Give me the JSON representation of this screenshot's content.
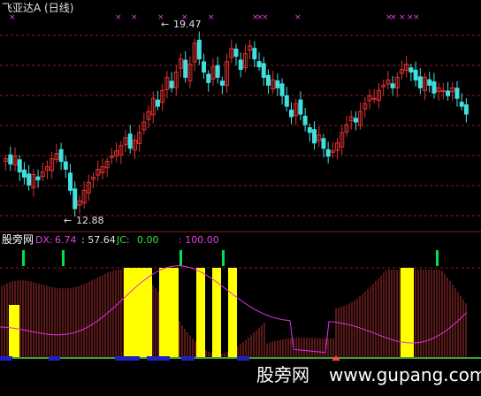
{
  "title": "飞亚达A (日线)",
  "high_label": "19.47",
  "low_label": "12.88",
  "indicator": {
    "name": "股旁网",
    "dx_label": "DX:",
    "dx_value": "6.74",
    "mid_value": ": 57.64",
    "jc_label": "JC:",
    "jc_value": "0.00",
    "last_value": ": 100.00"
  },
  "watermark": {
    "cn": "股旁网",
    "url": "www.gupang.com"
  },
  "colors": {
    "background": "#000000",
    "up": "#e03030",
    "down": "#40e0e0",
    "grid": "#8b2020",
    "marker": "#e040e0",
    "yellow": "#ffff00",
    "green": "#00e050",
    "purple_line": "#e030e0",
    "blue_bar": "#2020c0"
  },
  "chart_data": [
    {
      "type": "candlestick",
      "title": "飞亚达A (日线)",
      "close": [
        14.8,
        14.6,
        14.9,
        14.3,
        14.1,
        13.8,
        14.2,
        14.0,
        14.3,
        14.5,
        14.8,
        15.0,
        14.7,
        14.4,
        13.6,
        12.9,
        13.2,
        13.6,
        13.9,
        14.1,
        14.4,
        14.5,
        14.7,
        14.9,
        15.1,
        15.3,
        15.6,
        15.2,
        15.5,
        15.8,
        16.2,
        16.6,
        17.1,
        16.8,
        17.4,
        17.9,
        17.5,
        18.1,
        18.6,
        17.9,
        18.4,
        19.2,
        18.6,
        18.1,
        17.7,
        18.3,
        17.9,
        17.6,
        18.5,
        19.0,
        18.7,
        18.2,
        18.8,
        19.1,
        18.6,
        18.3,
        17.9,
        17.6,
        17.8,
        17.5,
        17.2,
        16.8,
        16.4,
        16.9,
        16.5,
        16.1,
        15.8,
        15.4,
        15.7,
        15.2,
        14.9,
        15.1,
        15.4,
        15.8,
        16.1,
        16.4,
        16.2,
        16.6,
        16.9,
        17.2,
        17.1,
        17.4,
        17.6,
        17.8,
        17.5,
        17.9,
        18.2,
        18.4,
        18.1,
        17.8,
        17.5,
        17.9,
        17.6,
        17.3,
        17.5,
        17.4,
        17.2,
        17.5,
        17.1,
        16.8,
        16.5
      ],
      "up_markers_x_index": [
        3,
        14,
        27,
        34,
        45,
        55,
        61,
        68,
        74,
        80,
        93,
        98
      ],
      "marked_values": {
        "high": 19.47,
        "low": 12.88
      }
    },
    {
      "type": "bar",
      "title": "股旁网",
      "series": [
        {
          "name": "DX",
          "last": 6.74
        },
        {
          "name": "JC",
          "last": 0.0
        }
      ]
    }
  ]
}
